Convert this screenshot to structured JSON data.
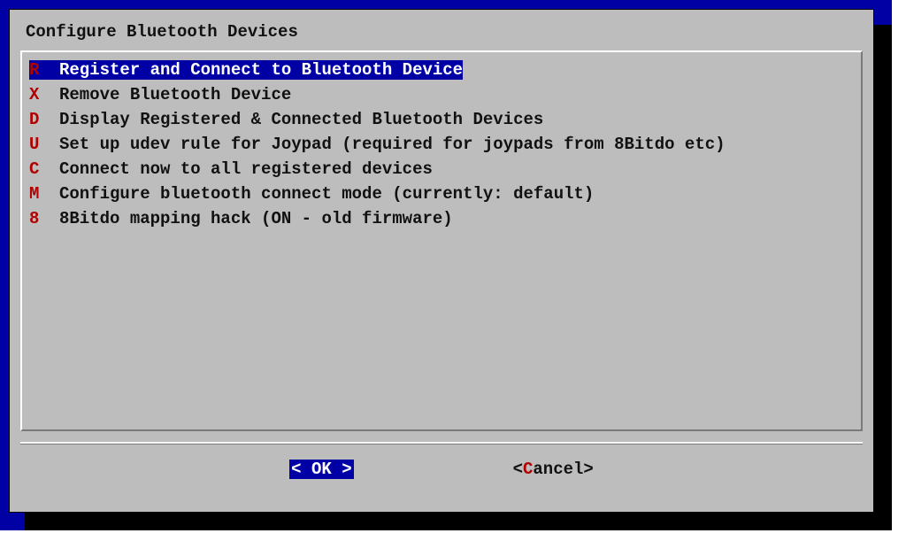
{
  "title": "Configure Bluetooth Devices",
  "menu": [
    {
      "key": "R",
      "label": "Register and Connect to Bluetooth Device",
      "selected": true
    },
    {
      "key": "X",
      "label": "Remove Bluetooth Device",
      "selected": false
    },
    {
      "key": "D",
      "label": "Display Registered & Connected Bluetooth Devices",
      "selected": false
    },
    {
      "key": "U",
      "label": "Set up udev rule for Joypad (required for joypads from 8Bitdo etc)",
      "selected": false
    },
    {
      "key": "C",
      "label": "Connect now to all registered devices",
      "selected": false
    },
    {
      "key": "M",
      "label": "Configure bluetooth connect mode (currently: default)",
      "selected": false
    },
    {
      "key": "8",
      "label": "8Bitdo mapping hack (ON - old firmware)",
      "selected": false
    }
  ],
  "buttons": {
    "ok": {
      "open": "<",
      "pad": " ",
      "hot": "O",
      "rest": "K",
      "close": ">"
    },
    "cancel": {
      "open": "<",
      "hot": "C",
      "rest": "ancel",
      "close": ">"
    }
  },
  "colors": {
    "bg_blue": "#0000a5",
    "panel_gray": "#bdbdbd",
    "hotkey_red": "#b00000",
    "shadow_black": "#000000"
  }
}
